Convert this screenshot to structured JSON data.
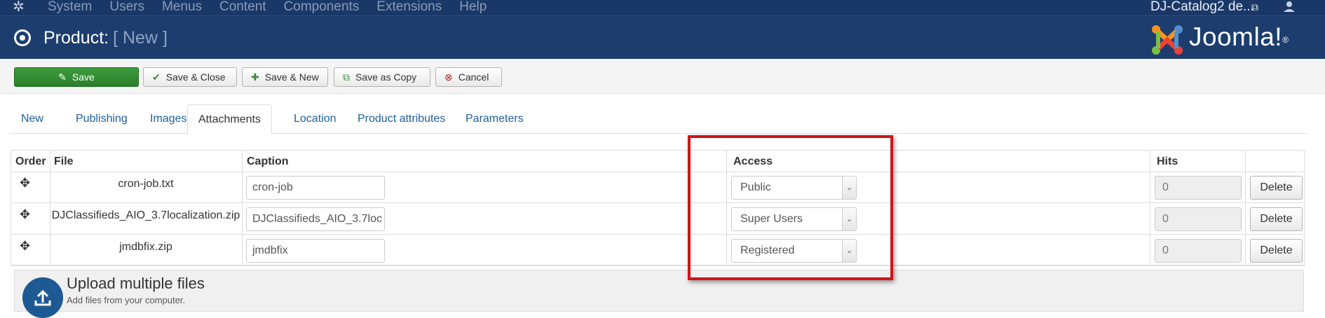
{
  "topbar": {
    "menu": [
      "System",
      "Users",
      "Menus",
      "Content",
      "Components",
      "Extensions",
      "Help"
    ],
    "site_link": "DJ-Catalog2 de..."
  },
  "header": {
    "title": "Product:",
    "subtitle": "[ New ]",
    "logo_text": "Joomla!",
    "logo_reg": "®"
  },
  "toolbar": {
    "save": "Save",
    "save_close": "Save & Close",
    "save_new": "Save & New",
    "save_copy": "Save as Copy",
    "cancel": "Cancel"
  },
  "tabs": [
    "New",
    "Publishing",
    "Images",
    "Attachments",
    "Location",
    "Product attributes",
    "Parameters"
  ],
  "active_tab": "Attachments",
  "table": {
    "headers": {
      "order": "Order",
      "file": "File",
      "caption": "Caption",
      "access": "Access",
      "hits": "Hits"
    },
    "rows": [
      {
        "file": "cron-job.txt",
        "caption": "cron-job",
        "access": "Public",
        "hits": "0",
        "delete": "Delete"
      },
      {
        "file": "DJClassifieds_AIO_3.7localization.zip",
        "caption": "DJClassifieds_AIO_3.7loc",
        "access": "Super Users",
        "hits": "0",
        "delete": "Delete"
      },
      {
        "file": "jmdbfix.zip",
        "caption": "jmdbfix",
        "access": "Registered",
        "hits": "0",
        "delete": "Delete"
      }
    ]
  },
  "upload": {
    "title": "Upload multiple files",
    "subtitle": "Add files from your computer."
  },
  "colors": {
    "topbar": "#1a3867",
    "header": "#1c3d6e",
    "save_button": "#2b7f2b",
    "link": "#1f5e9c",
    "highlight": "#d0141a"
  }
}
